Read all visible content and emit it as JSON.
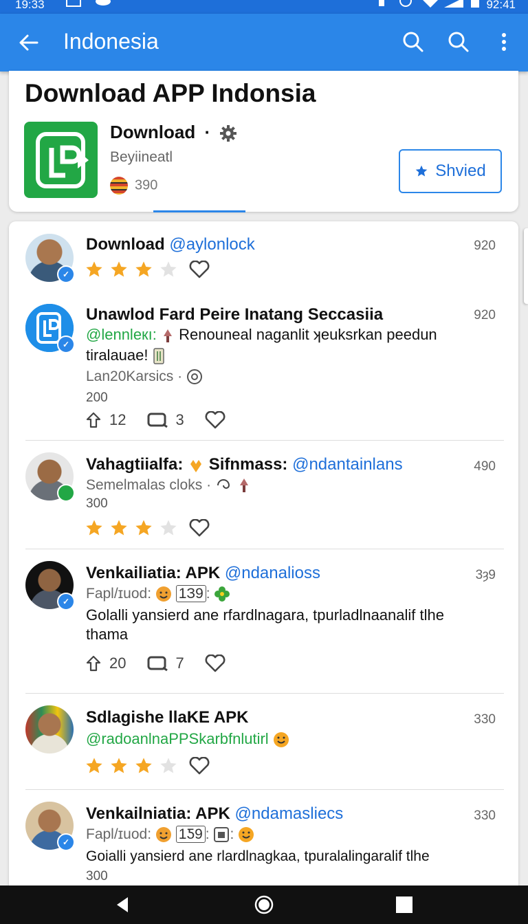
{
  "status": {
    "time": "19:33",
    "right_time": "92:41"
  },
  "appbar": {
    "title": "Indonesia"
  },
  "hero": {
    "heading": "Download APP Indonsia",
    "app_name": "Download",
    "app_subtitle": "Beyiineatl",
    "app_count": "390",
    "save_label": "Shvied"
  },
  "posts": [
    {
      "name": "Download",
      "handle": "@aylonlock",
      "time": "920",
      "stars": 3
    },
    {
      "name": "Unawlod  Fard Peire Inatang Seccasiia",
      "handle": "@lennleкı:",
      "text1": "Renouneal naganlit ʞeuksrkan peedun",
      "text2": "tiralauae!",
      "meta": "Lan20Karsics",
      "count": "200",
      "time": "920",
      "reposts": "12",
      "shares": "3"
    },
    {
      "name": "Vahagtiialfa:",
      "name2": "Sifnmass:",
      "handle": "@ndantainlans",
      "meta": "Semelmalas cloks",
      "count": "300",
      "time": "490",
      "stars": 3
    },
    {
      "name": "Venkailiatia: APK",
      "handle": "@ndanalioss",
      "meta": "Fapl/ɪuod:",
      "box": "1З9",
      "text1": "Golalli yansierd ane rfardlnagara, tpurladlnaanalif tlhe",
      "text2": "thama",
      "time": "3ȝ9",
      "reposts": "20",
      "shares": "7"
    },
    {
      "name": "Sdlagishe llaKE APK",
      "handle": "@radoanlnaPPSkarbfnlutirl",
      "time": "330",
      "stars": 3
    },
    {
      "name": "Venkailniatia: APK",
      "handle": "@ndamasliecs",
      "meta": "Fapl/ɪuod:",
      "box": "1Ƽ9",
      "text1": "Goialli yansierd ane rlardlnagkaa, tpuralalingaralif tlhe",
      "count": "300",
      "time": "330"
    }
  ],
  "colors": {
    "appbar": "#2b86e8",
    "accent": "#1e6fd9",
    "star": "#f5a623",
    "logo_green": "#22a745"
  },
  "icons": [
    "back-arrow-icon",
    "search-icon",
    "more-vert-icon",
    "gear-icon",
    "star-icon",
    "heart-icon",
    "repost-icon",
    "share-icon",
    "verified-badge-icon"
  ]
}
